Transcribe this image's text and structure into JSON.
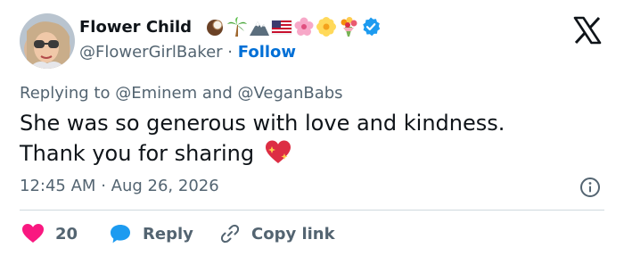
{
  "user": {
    "display_name": "Flower Child",
    "emoji_icons": [
      "coconut-emoji",
      "palm-tree-emoji",
      "snow-mountain-emoji",
      "us-flag-emoji",
      "cherry-blossom-emoji",
      "blossom-emoji",
      "bouquet-emoji",
      "verified-badge-icon"
    ],
    "handle": "@FlowerGirlBaker",
    "separator": "·",
    "follow_label": "Follow"
  },
  "reply_context": {
    "prefix": "Replying to",
    "mention_1": "@Eminem",
    "conjunction": "and",
    "mention_2": "@VeganBabs"
  },
  "tweet": {
    "line_1": "She was so generous with love and kindness.",
    "line_2": "Thank you for sharing",
    "trailing_icon": "sparkling-heart-emoji"
  },
  "meta": {
    "time": "12:45 AM",
    "separator": "·",
    "date": "Aug 26, 2026"
  },
  "actions": {
    "like_count": "20",
    "reply_label": "Reply",
    "copy_link_label": "Copy link"
  },
  "colors": {
    "link": "#006fd6",
    "like": "#f91880",
    "reply": "#1d9bf0",
    "text": "#0f1419",
    "muted": "#536471",
    "verified": "#1d9bf0"
  }
}
